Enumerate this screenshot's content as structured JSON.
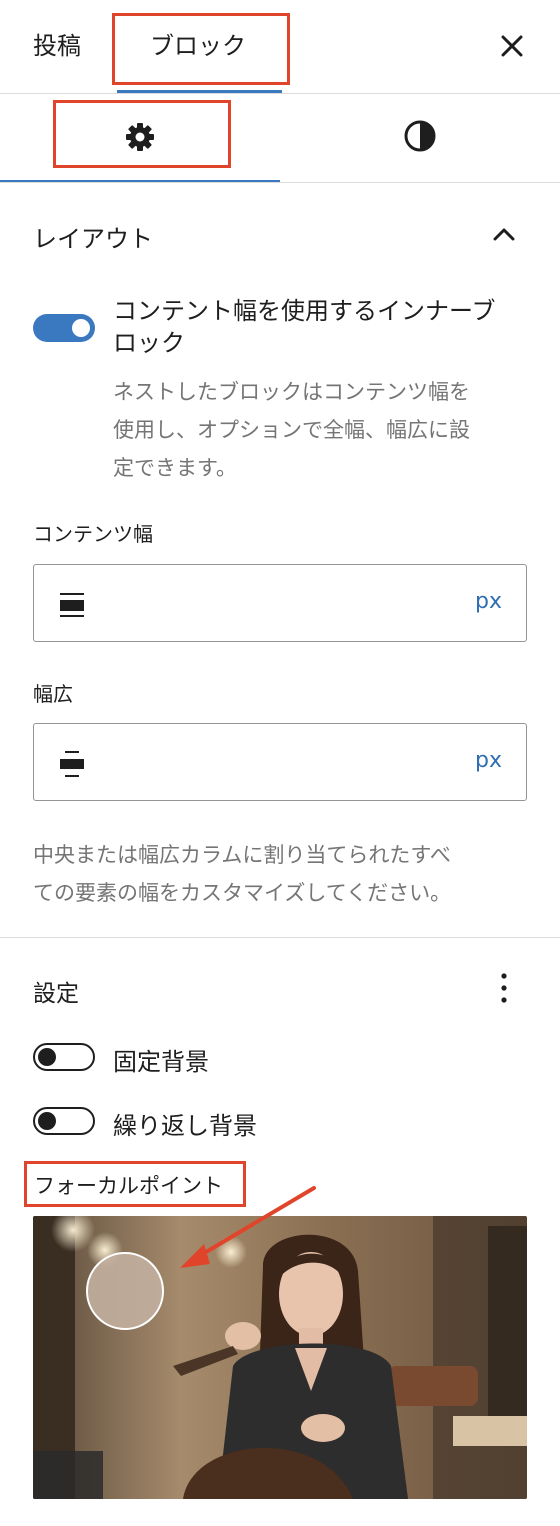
{
  "header": {
    "tabs": [
      {
        "label": "投稿"
      },
      {
        "label": "ブロック"
      }
    ],
    "close_icon": "close-icon"
  },
  "subtabs": {
    "settings_icon": "gear-icon",
    "styles_icon": "half-circle-contrast-icon"
  },
  "layout": {
    "title": "レイアウト",
    "toggle_label_line1": "コンテント幅を使用するインナーブ",
    "toggle_label_line2": "ロック",
    "toggle_on": true,
    "help_lines": [
      "ネストしたブロックはコンテンツ幅を",
      "使用し、オプションで全幅、幅広に設",
      "定できます。"
    ],
    "content_width": {
      "label": "コンテンツ幅",
      "value": "",
      "unit": "px",
      "icon": "content-width-icon"
    },
    "wide_width": {
      "label": "幅広",
      "value": "",
      "unit": "px",
      "icon": "wide-width-icon"
    },
    "note_lines": [
      "中央または幅広カラムに割り当てられたすべ",
      "ての要素の幅をカスタマイズしてください。"
    ]
  },
  "settings": {
    "title": "設定",
    "menu_icon": "more-vertical-icon",
    "fixed_bg": {
      "label": "固定背景",
      "on": false
    },
    "repeat_bg": {
      "label": "繰り返し背景",
      "on": false
    },
    "focal_point_label": "フォーカルポイント"
  },
  "colors": {
    "accent": "#3a78c0",
    "highlight": "#e0452b"
  }
}
